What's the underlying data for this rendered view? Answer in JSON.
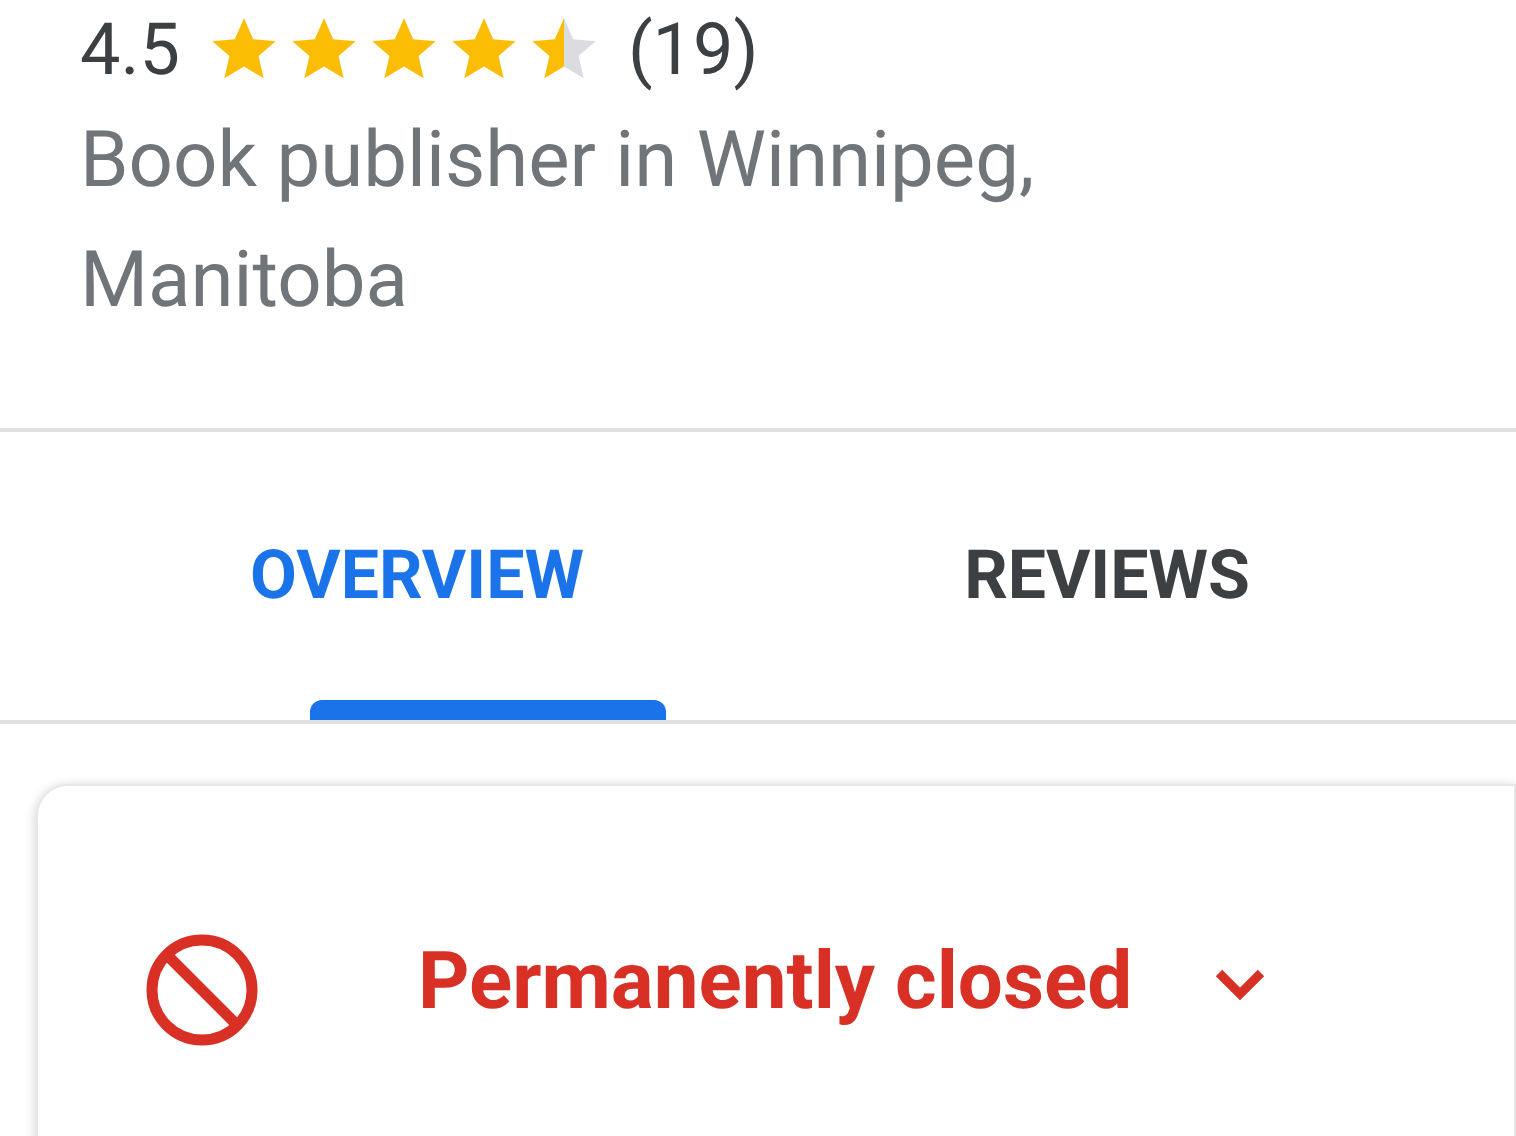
{
  "rating": {
    "score": "4.5",
    "stars": 4.5,
    "count": "(19)"
  },
  "description": "Book publisher in Winnipeg, Manitoba",
  "tabs": [
    {
      "label": "OVERVIEW",
      "selected": true
    },
    {
      "label": "REVIEWS",
      "selected": false
    }
  ],
  "status": {
    "label": "Permanently closed",
    "expanded": false
  }
}
